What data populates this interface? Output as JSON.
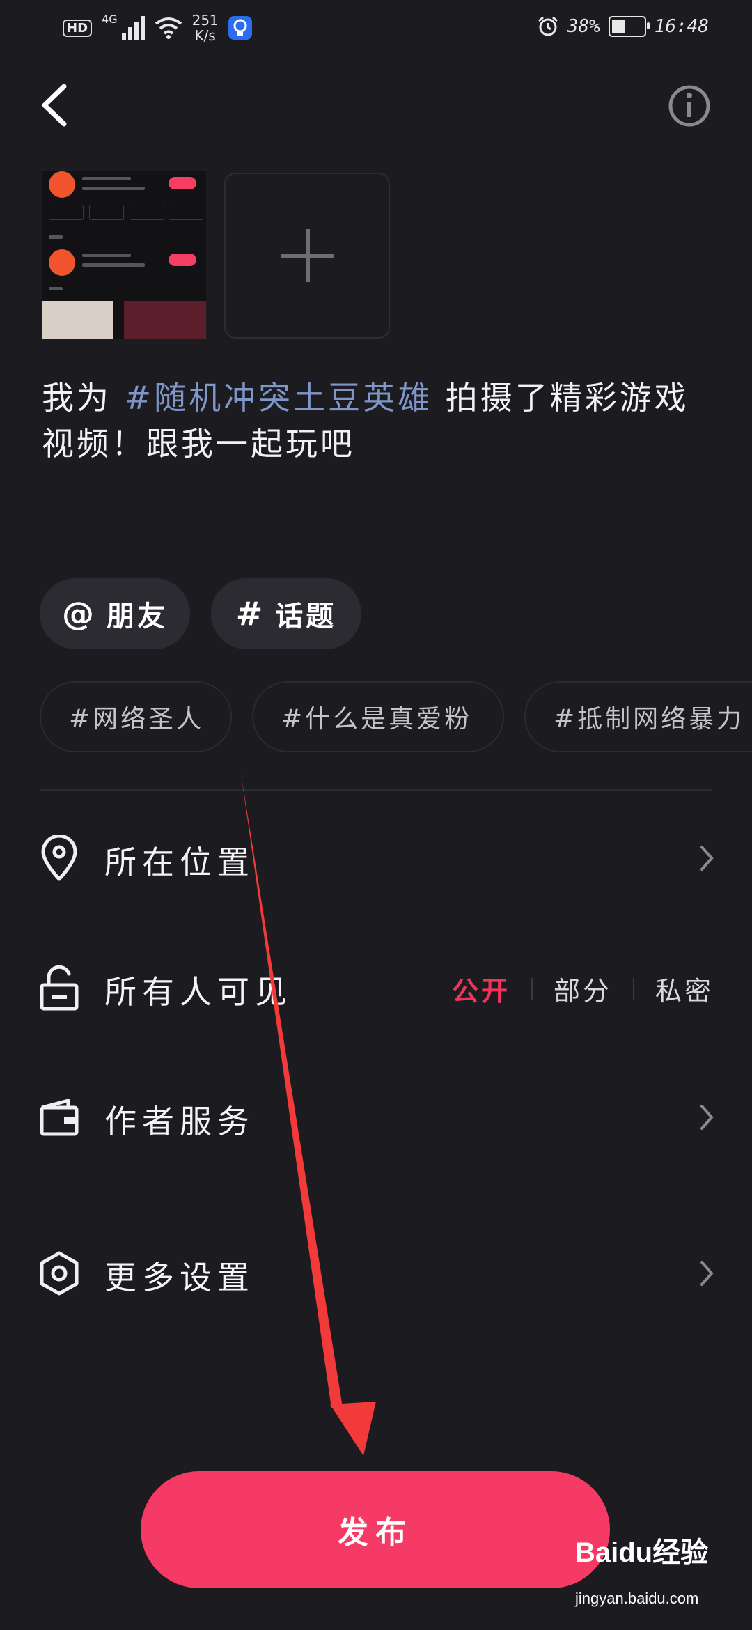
{
  "status_bar": {
    "hd": "HD",
    "network": "4G",
    "speed_value": "251",
    "speed_unit": "K/s",
    "battery": "38%",
    "time": "16:48"
  },
  "caption": {
    "prefix": "我为 ",
    "topic": "#随机冲突土豆英雄",
    "suffix": " 拍摄了精彩游戏视频！跟我一起玩吧"
  },
  "chips": {
    "friends_symbol": "@",
    "friends_label": "朋友",
    "topic_symbol": "#",
    "topic_label": "话题"
  },
  "suggested_topics": [
    "#网络圣人",
    "#什么是真爱粉",
    "#抵制网络暴力"
  ],
  "settings": {
    "location": "所在位置",
    "visibility": "所有人可见",
    "visibility_options": [
      "公开",
      "部分",
      "私密"
    ],
    "visibility_selected": "公开",
    "author_service": "作者服务",
    "more_settings": "更多设置"
  },
  "publish_label": "发布",
  "watermark": {
    "brand": "Baidu经验",
    "url": "jingyan.baidu.com"
  },
  "colors": {
    "accent": "#f53b65",
    "topic": "#7f96c8",
    "background": "#1c1b20"
  }
}
